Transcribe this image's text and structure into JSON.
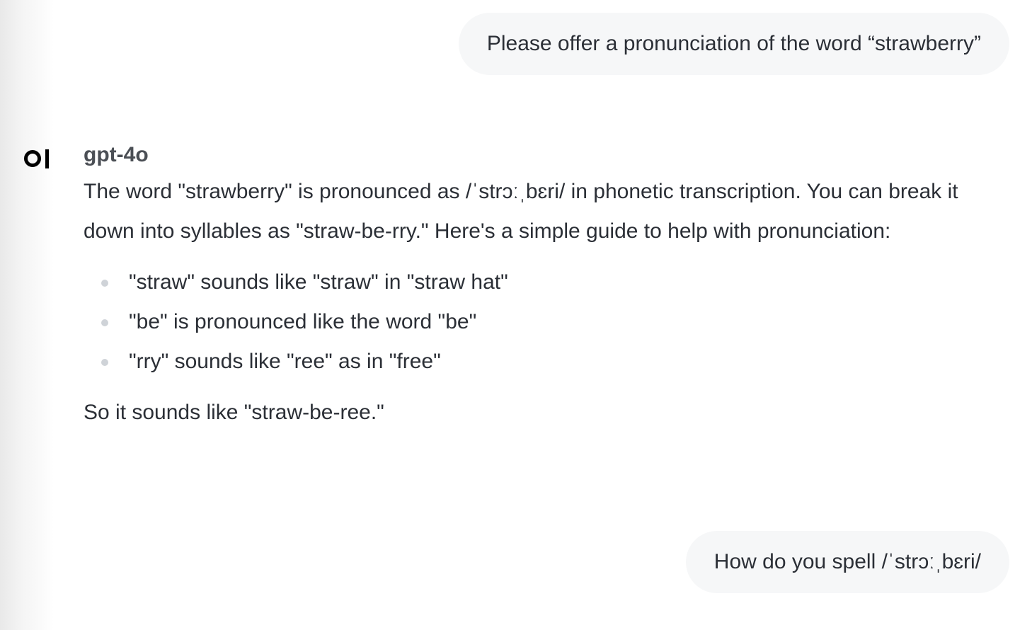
{
  "conversation": {
    "user_message_1": "Please offer a pronunciation of the word “strawberry”",
    "assistant": {
      "name": "gpt-4o",
      "logo_icon": "openwebui-logo-icon",
      "paragraph_1": "The word \"strawberry\" is pronounced as /ˈstrɔːˌbɛri/ in phonetic transcription. You can break it down into syllables as \"straw-be-rry.\" Here's a simple guide to help with pronunciation:",
      "bullets": [
        "\"straw\" sounds like \"straw\" in \"straw hat\"",
        "\"be\" is pronounced like the word \"be\"",
        "\"rry\" sounds like \"ree\" as in \"free\""
      ],
      "paragraph_2": "So it sounds like \"straw-be-ree.\""
    },
    "user_message_2": "How do you spell /ˈstrɔːˌbɛri/"
  },
  "colors": {
    "user_bubble_bg": "#f6f7f8",
    "text": "#2b2f36",
    "assistant_name": "#4b4f55",
    "bullet_dot": "#cfd3d8"
  }
}
